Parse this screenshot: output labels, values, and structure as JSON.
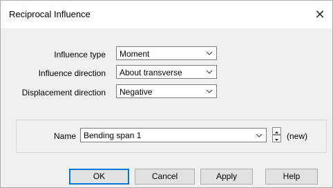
{
  "window": {
    "title": "Reciprocal Influence"
  },
  "fields": {
    "influence_type": {
      "label": "Influence type",
      "value": "Moment"
    },
    "influence_direction": {
      "label": "Influence direction",
      "value": "About transverse"
    },
    "displacement_direction": {
      "label": "Displacement direction",
      "value": "Negative"
    }
  },
  "name": {
    "label": "Name",
    "value": "Bending span 1",
    "status": "(new)"
  },
  "buttons": {
    "ok": "OK",
    "cancel": "Cancel",
    "apply": "Apply",
    "help": "Help"
  },
  "icons": {
    "close": "close-icon",
    "dropdown": "chevron-down-icon",
    "spin_up": "spin-up-icon",
    "spin_down": "spin-down-icon"
  }
}
